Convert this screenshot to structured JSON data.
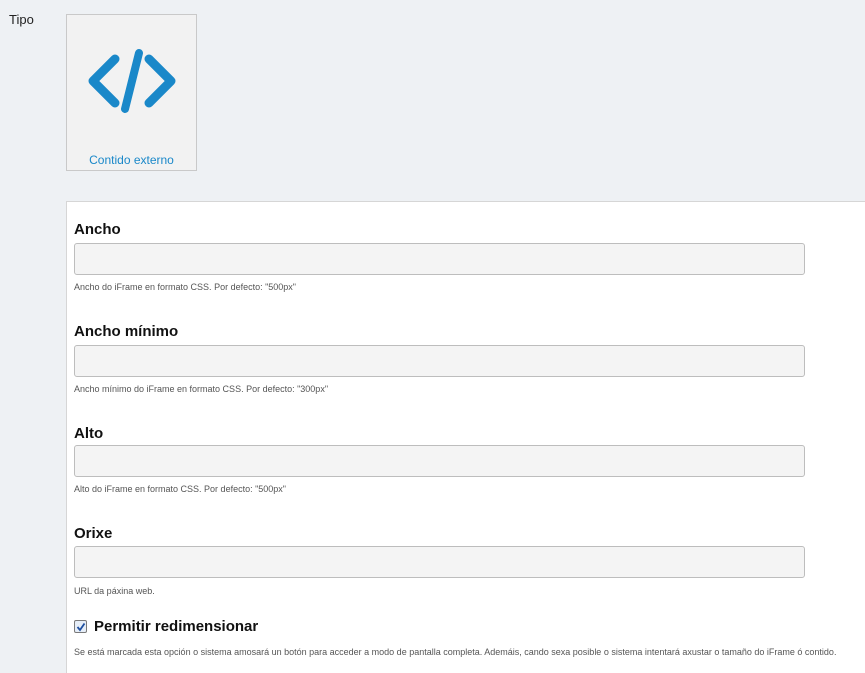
{
  "type_label": "Tipo",
  "type_card": {
    "icon": "code-icon",
    "caption": "Contido externo",
    "accent": "#1a88c9"
  },
  "fields": [
    {
      "label": "Ancho",
      "value": "",
      "description": "Ancho do iFrame en formato CSS. Por defecto: \"500px\""
    },
    {
      "label": "Ancho mínimo",
      "value": "",
      "description": "Ancho mínimo do iFrame en formato CSS. Por defecto: \"300px\""
    },
    {
      "label": "Alto",
      "value": "",
      "description": "Alto do iFrame en formato CSS. Por defecto: \"500px\""
    },
    {
      "label": "Orixe",
      "value": "",
      "description": "URL da páxina web."
    }
  ],
  "resize_option": {
    "label": "Permitir redimensionar",
    "checked": true,
    "description": "Se está marcada esta opción o sistema amosará un botón para acceder a modo de pantalla completa. Ademáis, cando sexa posible o sistema intentará axustar o tamaño do iFrame ó contido."
  }
}
